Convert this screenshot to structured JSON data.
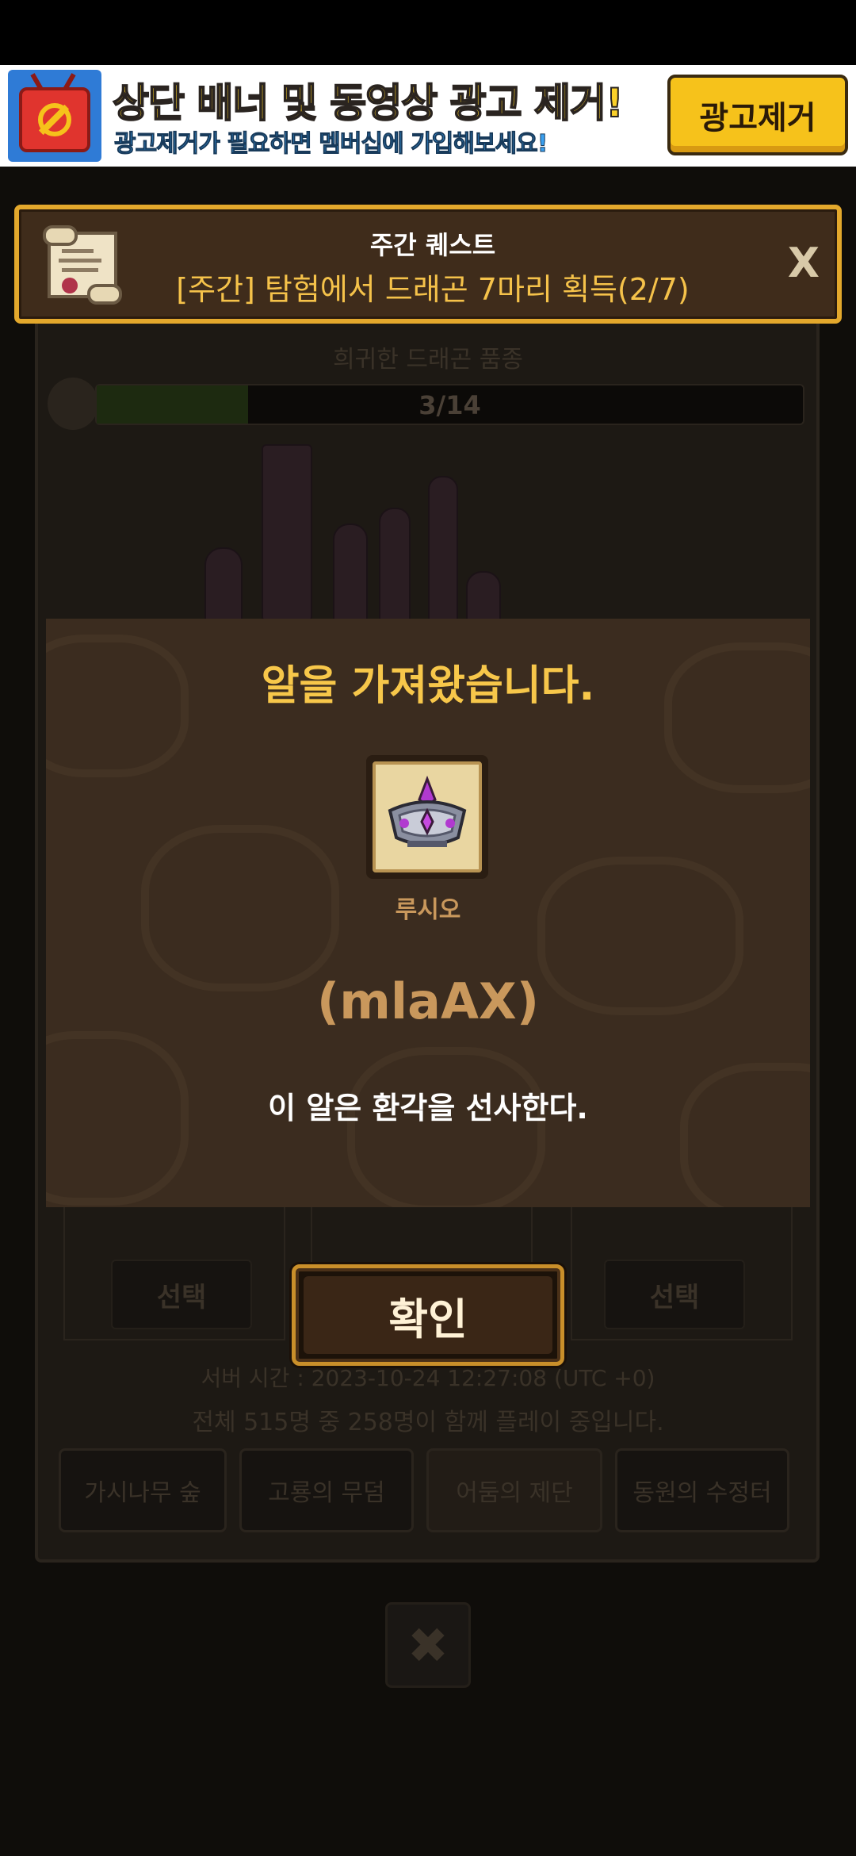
{
  "ad_banner": {
    "title": "상단 배너 및 동영상 광고 제거!",
    "subtitle": "광고제거가 필요하면 멤버십에 가입해보세요!",
    "button_label": "광고제거"
  },
  "quest": {
    "title": "주간 퀘스트",
    "description": "[주간] 탐험에서 드래곤 7마리 획득(2/7)",
    "close_label": "X"
  },
  "background": {
    "egg_label": "희귀한 드래곤 품종",
    "progress_text": "3/14",
    "progress_fraction": 0.214,
    "select_label": "선택",
    "server_time": "서버 시간 : 2023-10-24 12:27:08 (UTC +0)",
    "players_text": "전체 515명 중 258명이 함께 플레이 중입니다.",
    "tabs": [
      "가시나무 숲",
      "고룡의 무덤",
      "어둠의 제단",
      "동원의 수정터"
    ],
    "close_label": "✖"
  },
  "modal": {
    "title": "알을 가져왔습니다.",
    "egg_name": "루시오",
    "egg_code": "(mlaAX)",
    "description": "이 알은 환각을 선사한다.",
    "confirm_label": "확인"
  }
}
